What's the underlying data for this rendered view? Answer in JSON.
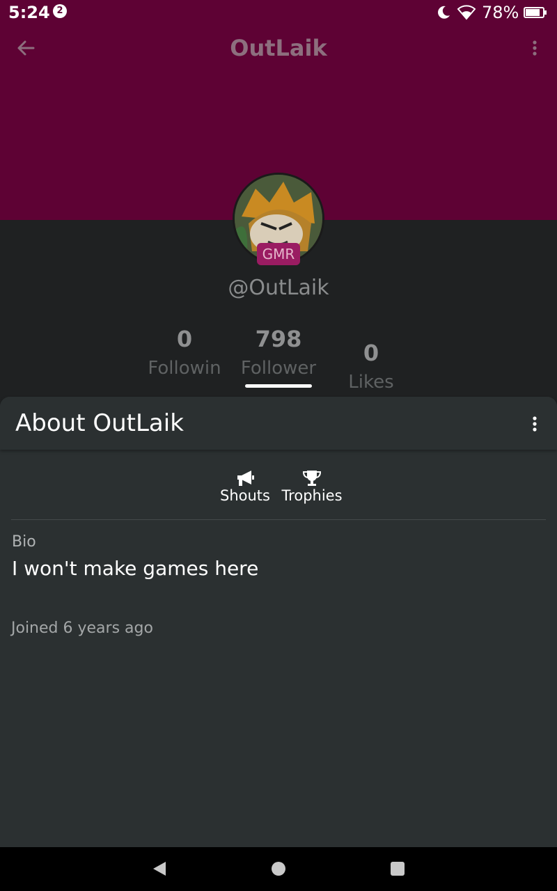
{
  "status_bar": {
    "time": "5:24",
    "notification_count": "2",
    "battery": "78%"
  },
  "app_bar": {
    "title": "OutLaik"
  },
  "profile": {
    "badge": "GMR",
    "username": "@OutLaik",
    "stats": {
      "following": {
        "value": "0",
        "label": "Followin"
      },
      "followers": {
        "value": "798",
        "label": "Follower"
      },
      "likes": {
        "value": "0",
        "label": "Likes"
      }
    }
  },
  "sheet": {
    "title": "About OutLaik",
    "tabs": [
      {
        "label": "Shouts",
        "icon": "megaphone-icon"
      },
      {
        "label": "Trophies",
        "icon": "trophy-icon"
      }
    ],
    "bio_label": "Bio",
    "bio_text": "I won't make games here",
    "joined": "Joined 6 years ago"
  },
  "colors": {
    "banner": "#5e0234",
    "background": "#1f2122",
    "sheet": "#2b3031",
    "badge": "#9a1c62"
  }
}
